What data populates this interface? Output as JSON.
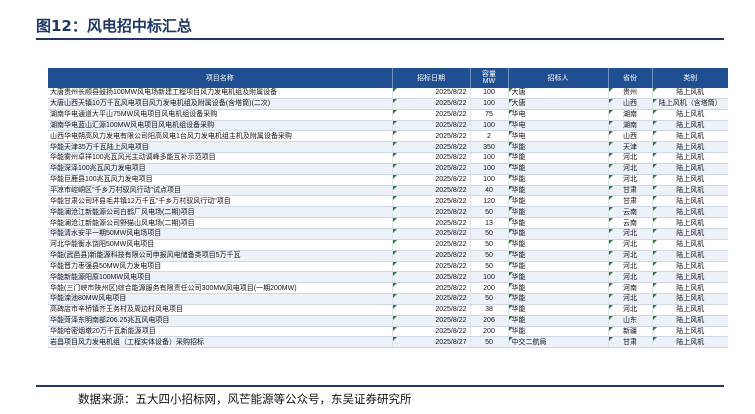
{
  "figure_title": "图12：风电招中标汇总",
  "table": {
    "headers": [
      "项目名称",
      "招标日期",
      "容量\nMW",
      "招标人",
      "省份",
      "类别"
    ],
    "rows": [
      [
        "大唐贵州长顺县鼓扬100MW风电场新建工程项目风力发电机组及附属设备",
        "2025/8/22",
        "100",
        "大唐",
        "贵州",
        "陆上风机"
      ],
      [
        "大唐山西天镇10万千瓦风电项目风力发电机组及附属设备(含塔筒)(二次)",
        "2025/8/22",
        "100",
        "大唐",
        "山西",
        "陆上风机（含塔筒）"
      ],
      [
        "湖南华电通道大平山75MW风电项目风电机组设备采购",
        "2025/8/22",
        "75",
        "华电",
        "湖南",
        "陆上风机"
      ],
      [
        "湖南华电蓝山汇源100MW风电项目风电机组设备采购",
        "2025/8/22",
        "100",
        "华电",
        "湖南",
        "陆上风机"
      ],
      [
        "山西华电朔高风力发电有限公司阳高风电1台风力发电机组主机及附属设备采购",
        "2025/8/22",
        "2",
        "华电",
        "山西",
        "陆上风机"
      ],
      [
        "华能天津35万千瓦陆上风电项目",
        "2025/8/22",
        "350",
        "华能",
        "天津",
        "陆上风机"
      ],
      [
        "华能雾州卓祥100兆瓦风光主动调峰多能互补示范项目",
        "2025/8/22",
        "100",
        "华能",
        "河北",
        "陆上风机"
      ],
      [
        "华能深泽100兆瓦风力发电项目",
        "2025/8/22",
        "100",
        "华能",
        "河北",
        "陆上风机"
      ],
      [
        "华能巨鹿县100兆瓦风力发电项目",
        "2025/8/22",
        "100",
        "华能",
        "河北",
        "陆上风机"
      ],
      [
        "平凉市崆峒区\"千乡万村驭风行动\"试点项目",
        "2025/8/22",
        "40",
        "华能",
        "甘肃",
        "陆上风机"
      ],
      [
        "华能甘肃公司环县毛井镇12万千瓦\"千乡万村驭风行动\"项目",
        "2025/8/22",
        "120",
        "华能",
        "甘肃",
        "陆上风机"
      ],
      [
        "华能澜沧江新能源公司白鹤厂风电场(二期)项目",
        "2025/8/22",
        "50",
        "华能",
        "云南",
        "陆上风机"
      ],
      [
        "华能澜沧江新能源公司野猫山风电场(二期)项目",
        "2025/8/22",
        "13",
        "华能",
        "云南",
        "陆上风机"
      ],
      [
        "华能清水安平一期50MW风电场项目",
        "2025/8/22",
        "50",
        "华能",
        "河北",
        "陆上风机"
      ],
      [
        "河北华能衡水饶阳50MW风电项目",
        "2025/8/22",
        "50",
        "华能",
        "河北",
        "陆上风机"
      ],
      [
        "华能(武邑县)新能源科技有限公司申报风电储备类项目5万千瓦",
        "2025/8/22",
        "50",
        "华能",
        "河北",
        "陆上风机"
      ],
      [
        "华能晋力枣强县50MW风力发电项目",
        "2025/8/22",
        "50",
        "华能",
        "河北",
        "陆上风机"
      ],
      [
        "华能新能源阳原100MW风电项目",
        "2025/8/22",
        "100",
        "华能",
        "河北",
        "陆上风机"
      ],
      [
        "华能(三门峡市陕州区)综合能源服务有限责任公司300MW风电项目(一期200MW)",
        "2025/8/22",
        "200",
        "华能",
        "河南",
        "陆上风机"
      ],
      [
        "华能滦池80MW风电项目",
        "2025/8/22",
        "50",
        "华能",
        "河北",
        "陆上风机"
      ],
      [
        "高碑店市辛桥镇齐王务村及周边村风电项目",
        "2025/8/22",
        "38",
        "华能",
        "河北",
        "陆上风机"
      ],
      [
        "华能菏泽东明南部206.25兆瓦风电项目",
        "2025/8/22",
        "206",
        "华能",
        "山东",
        "陆上风机"
      ],
      [
        "华能哈密烟墩20万千瓦新能源项目",
        "2025/8/22",
        "200",
        "华能",
        "新疆",
        "陆上风机"
      ],
      [
        "岩昌项目风力发电机组（工程实体设备）采购招标",
        "2025/8/27",
        "50",
        "中交二航局",
        "甘肃",
        "陆上风机"
      ]
    ]
  },
  "source_note": "数据来源：五大四小招标网，风芒能源等公众号，东吴证券研究所",
  "colors": {
    "title": "#1f3864",
    "header_bg": "#1f4e91",
    "stripe": "#edf2f9",
    "marker": "#2e7d32"
  }
}
